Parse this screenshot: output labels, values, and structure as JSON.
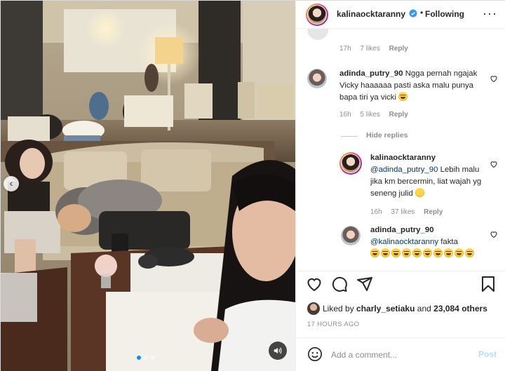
{
  "post": {
    "username": "kalinaocktaranny",
    "follow_status": "Following",
    "separator": "•",
    "more_label": "···"
  },
  "comments": {
    "top_meta": {
      "time": "17h",
      "likes": "7 likes",
      "reply": "Reply"
    },
    "c1": {
      "username": "adinda_putry_90",
      "text": "Ngga pernah ngajak Vicky haaaaaa pasti aska malu punya bapa tiri ya vicki",
      "emoji": "grinning-sweat",
      "time": "16h",
      "likes": "5 likes",
      "reply": "Reply"
    },
    "hide_replies": "Hide replies",
    "r1": {
      "username": "kalinaocktaranny",
      "mention": "@adinda_putry_90",
      "text": "Lebih malu jika km bercermin, liat wajah yg seneng julid",
      "emoji": "smiling-face",
      "time": "16h",
      "likes": "37 likes",
      "reply": "Reply"
    },
    "r2": {
      "username": "adinda_putry_90",
      "mention": "@kalinaocktaranny",
      "text": "fakta",
      "emoji": "face-with-tears-of-joy",
      "emoji_count": 10
    }
  },
  "actions": {
    "liked_by_prefix": "Liked by",
    "liked_by_user": "charly_setiaku",
    "liked_by_suffix": "and",
    "liked_by_count": "23,084 others",
    "timestamp": "17 HOURS AGO"
  },
  "composer": {
    "placeholder": "Add a comment...",
    "post_label": "Post"
  },
  "media": {
    "carousel_dots": 3,
    "active_dot": 1,
    "prev_symbol": "‹"
  },
  "colors": {
    "accent": "#0095f6",
    "link": "#00376b",
    "muted": "#8e8e8e",
    "text": "#262626",
    "post_disabled": "#b2dffc"
  },
  "icons": [
    "verified-badge-icon",
    "more-icon",
    "heart-icon",
    "comment-icon",
    "share-icon",
    "bookmark-icon",
    "emoji-icon",
    "sound-icon",
    "chevron-left-icon"
  ]
}
